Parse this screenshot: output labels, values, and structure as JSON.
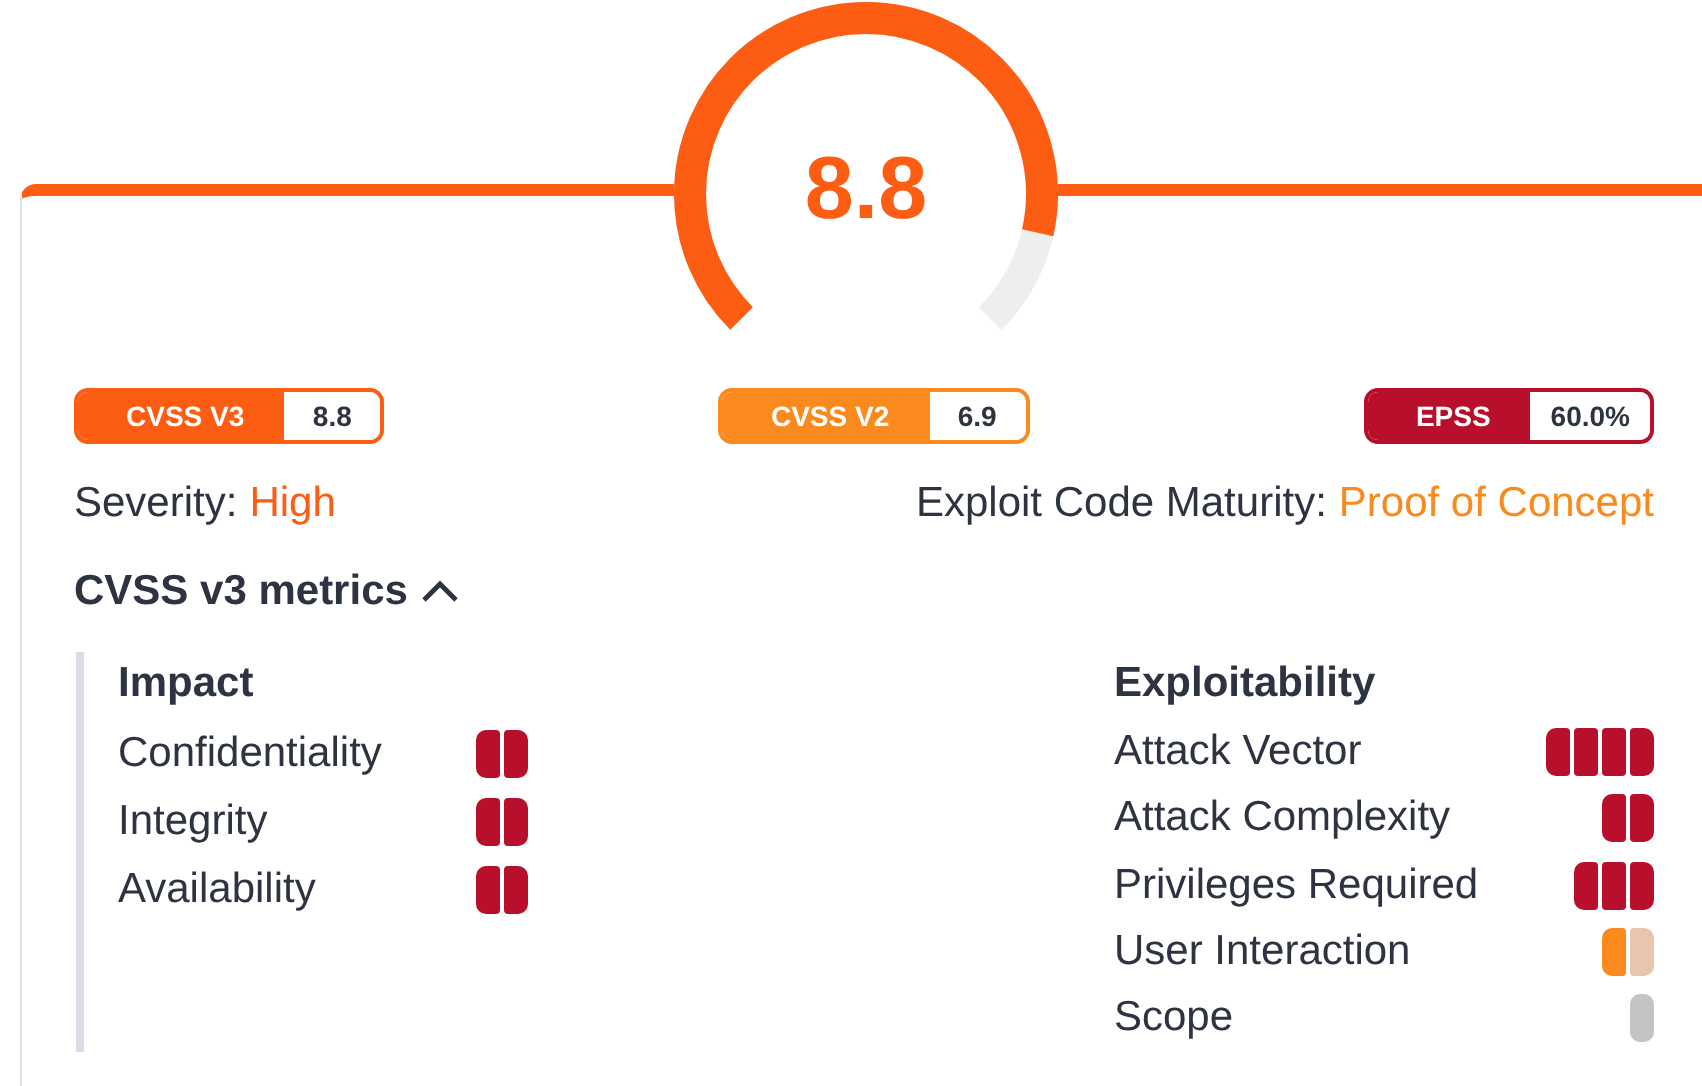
{
  "gauge": {
    "score": "8.8",
    "level": 0.88
  },
  "badges": [
    {
      "label": "CVSS V3",
      "value": "8.8",
      "color": "#fd5c13"
    },
    {
      "label": "CVSS V2",
      "value": "6.9",
      "color": "#fb8a1e"
    },
    {
      "label": "EPSS",
      "value": "60.0%",
      "color": "#b8102c"
    }
  ],
  "facts": [
    {
      "label": "Severity:",
      "value": "High",
      "color": "#fd5c13"
    },
    {
      "label": "Exploit Code Maturity:",
      "value": "Proof of Concept",
      "color": "#fb8a1e"
    }
  ],
  "metrics_section": {
    "title": "CVSS v3 metrics",
    "expanded": true
  },
  "groups": [
    {
      "title": "Impact",
      "metrics": [
        {
          "name": "Confidentiality",
          "segments": [
            {
              "color": "#b8102c"
            },
            {
              "color": "#b8102c"
            }
          ]
        },
        {
          "name": "Integrity",
          "segments": [
            {
              "color": "#b8102c"
            },
            {
              "color": "#b8102c"
            }
          ]
        },
        {
          "name": "Availability",
          "segments": [
            {
              "color": "#b8102c"
            },
            {
              "color": "#b8102c"
            }
          ]
        }
      ]
    },
    {
      "title": "Exploitability",
      "metrics": [
        {
          "name": "Attack Vector",
          "segments": [
            {
              "color": "#b8102c"
            },
            {
              "color": "#b8102c"
            },
            {
              "color": "#b8102c"
            },
            {
              "color": "#b8102c"
            }
          ]
        },
        {
          "name": "Attack Complexity",
          "segments": [
            {
              "color": "#b8102c"
            },
            {
              "color": "#b8102c"
            }
          ]
        },
        {
          "name": "Privileges Required",
          "segments": [
            {
              "color": "#b8102c"
            },
            {
              "color": "#b8102c"
            },
            {
              "color": "#b8102c"
            }
          ]
        },
        {
          "name": "User Interaction",
          "segments": [
            {
              "color": "#fb8a1e"
            },
            {
              "color": "#e8c6ad"
            }
          ]
        },
        {
          "name": "Scope",
          "segments": [
            {
              "color": "#c4c4c4"
            }
          ]
        }
      ]
    }
  ]
}
